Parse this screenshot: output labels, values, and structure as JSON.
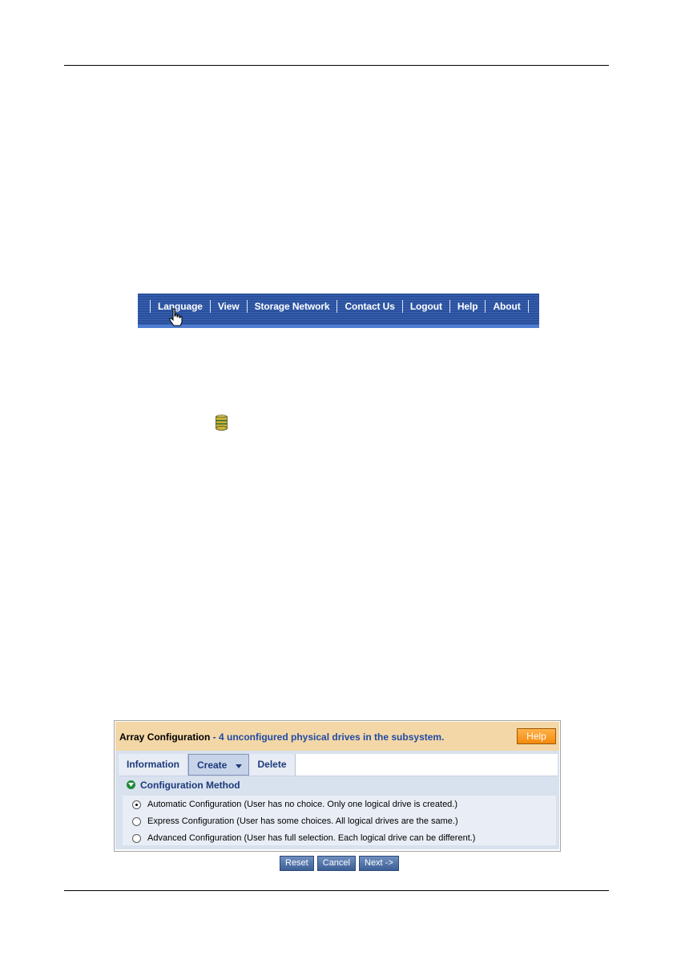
{
  "menu": {
    "items": [
      "Language",
      "View",
      "Storage Network",
      "Contact Us",
      "Logout",
      "Help",
      "About"
    ]
  },
  "panel": {
    "title": "Array Configuration",
    "subtitle": " - 4 unconfigured physical drives in the subsystem.",
    "help_label": "Help",
    "tabs": {
      "information": "Information",
      "create": "Create",
      "delete": "Delete"
    },
    "section_title": "Configuration Method",
    "options": [
      {
        "label": "Automatic Configuration (User has no choice. Only one logical drive is created.)",
        "checked": true
      },
      {
        "label": "Express Configuration (User has some choices. All logical drives are the same.)",
        "checked": false
      },
      {
        "label": "Advanced Configuration (User has full selection. Each logical drive can be different.)",
        "checked": false
      }
    ]
  },
  "buttons": {
    "reset": "Reset",
    "cancel": "Cancel",
    "next": "Next ->"
  },
  "colors": {
    "menu_bg": "#2a4f9b",
    "panel_header_bg": "#f4d7a6",
    "help_button": "#f48a0b",
    "section_icon": "#1f8a3a"
  }
}
